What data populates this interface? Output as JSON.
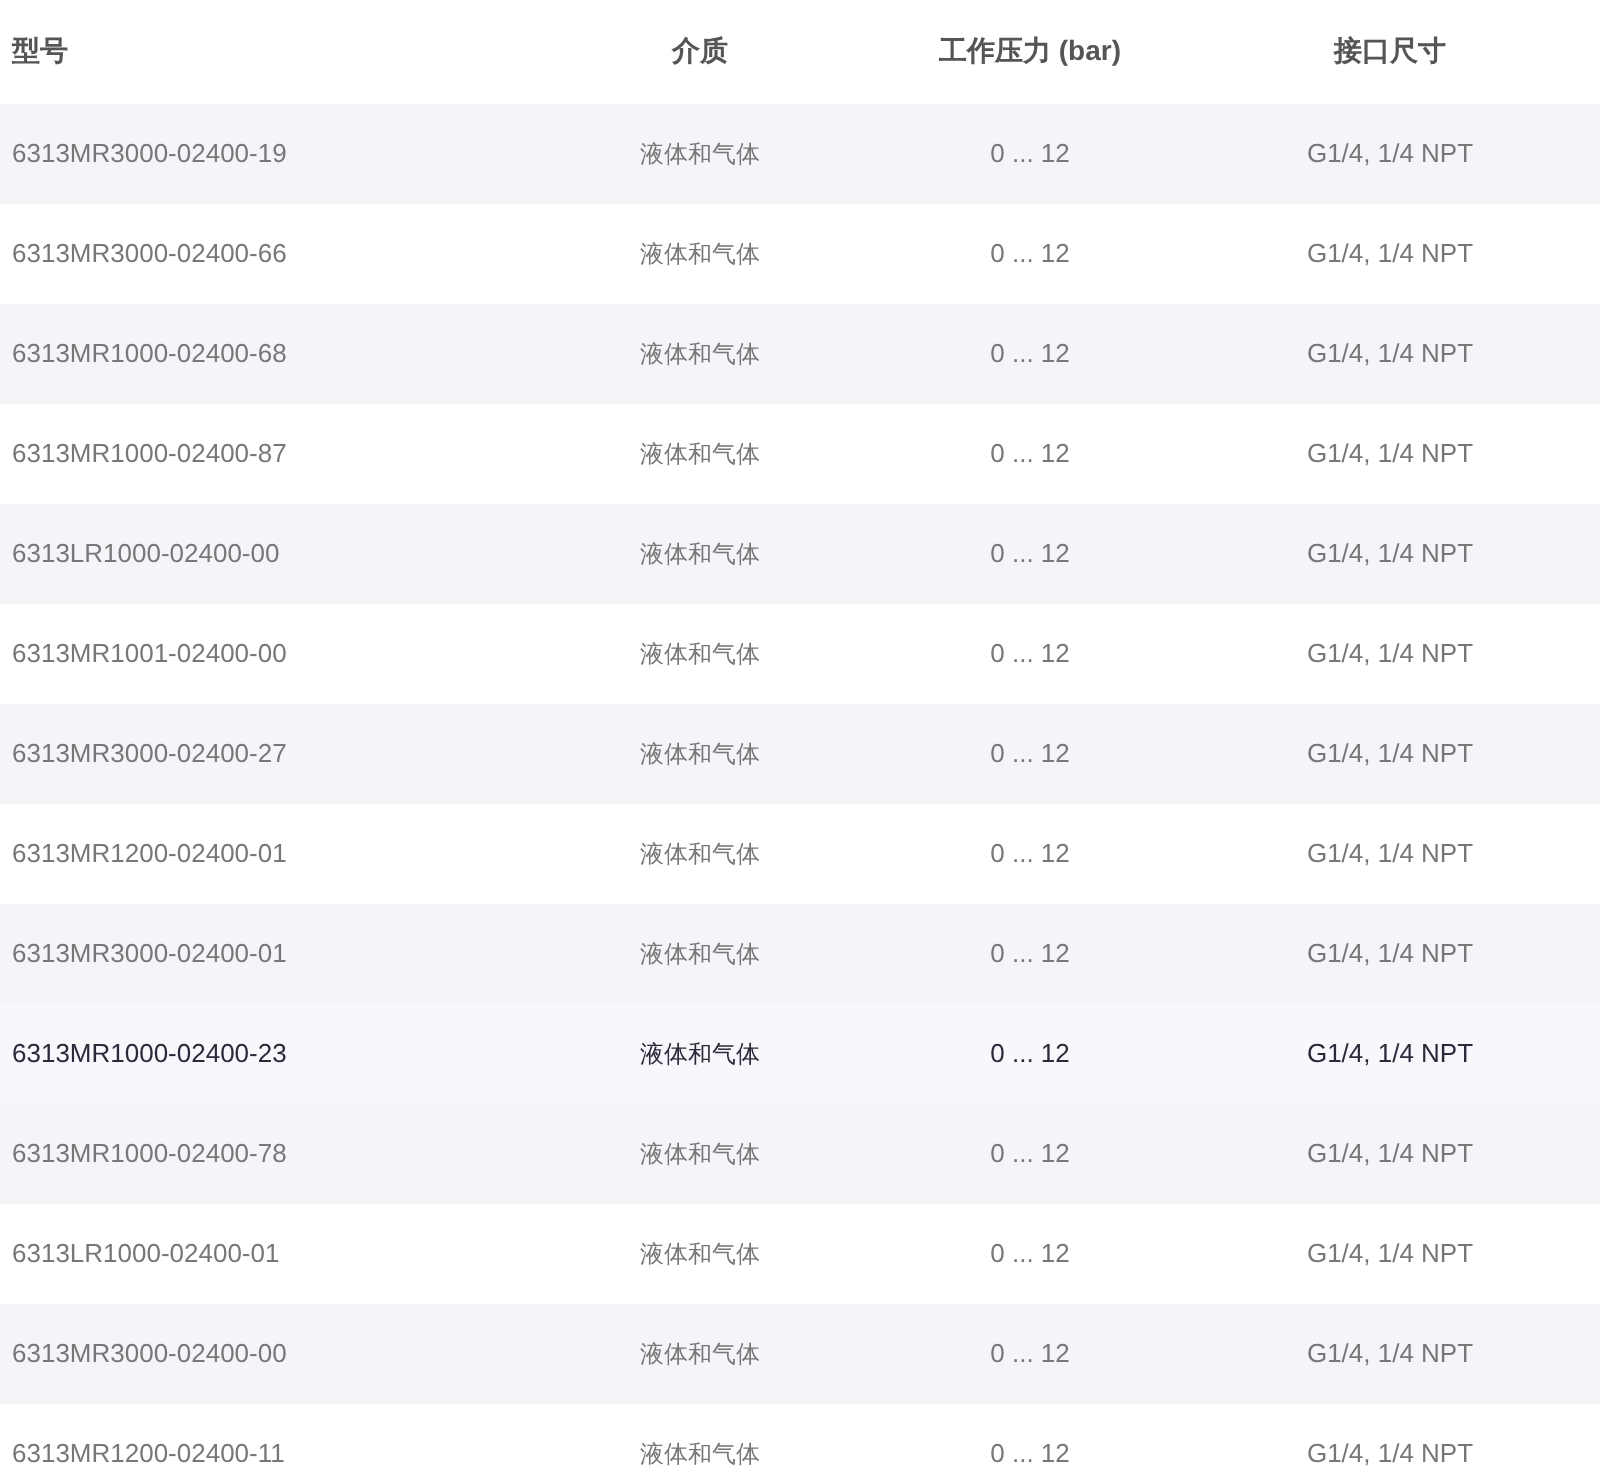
{
  "table": {
    "columns": [
      "型号",
      "介质",
      "工作压力 (bar)",
      "接口尺寸"
    ],
    "rows": [
      {
        "cells": [
          "6313MR3000-02400-19",
          "液体和气体",
          "0 ... 12",
          "G1/4, 1/4 NPT"
        ],
        "highlighted": false
      },
      {
        "cells": [
          "6313MR3000-02400-66",
          "液体和气体",
          "0 ... 12",
          "G1/4, 1/4 NPT"
        ],
        "highlighted": false
      },
      {
        "cells": [
          "6313MR1000-02400-68",
          "液体和气体",
          "0 ... 12",
          "G1/4, 1/4 NPT"
        ],
        "highlighted": false
      },
      {
        "cells": [
          "6313MR1000-02400-87",
          "液体和气体",
          "0 ... 12",
          "G1/4, 1/4 NPT"
        ],
        "highlighted": false
      },
      {
        "cells": [
          "6313LR1000-02400-00",
          "液体和气体",
          "0 ... 12",
          "G1/4, 1/4 NPT"
        ],
        "highlighted": false
      },
      {
        "cells": [
          "6313MR1001-02400-00",
          "液体和气体",
          "0 ... 12",
          "G1/4, 1/4 NPT"
        ],
        "highlighted": false
      },
      {
        "cells": [
          "6313MR3000-02400-27",
          "液体和气体",
          "0 ... 12",
          "G1/4, 1/4 NPT"
        ],
        "highlighted": false
      },
      {
        "cells": [
          "6313MR1200-02400-01",
          "液体和气体",
          "0 ... 12",
          "G1/4, 1/4 NPT"
        ],
        "highlighted": false
      },
      {
        "cells": [
          "6313MR3000-02400-01",
          "液体和气体",
          "0 ... 12",
          "G1/4, 1/4 NPT"
        ],
        "highlighted": false
      },
      {
        "cells": [
          "6313MR1000-02400-23",
          "液体和气体",
          "0 ... 12",
          "G1/4, 1/4 NPT"
        ],
        "highlighted": true
      },
      {
        "cells": [
          "6313MR1000-02400-78",
          "液体和气体",
          "0 ... 12",
          "G1/4, 1/4 NPT"
        ],
        "highlighted": false
      },
      {
        "cells": [
          "6313LR1000-02400-01",
          "液体和气体",
          "0 ... 12",
          "G1/4, 1/4 NPT"
        ],
        "highlighted": false
      },
      {
        "cells": [
          "6313MR3000-02400-00",
          "液体和气体",
          "0 ... 12",
          "G1/4, 1/4 NPT"
        ],
        "highlighted": false
      },
      {
        "cells": [
          "6313MR1200-02400-11",
          "液体和气体",
          "0 ... 12",
          "G1/4, 1/4 NPT"
        ],
        "highlighted": false
      }
    ]
  }
}
